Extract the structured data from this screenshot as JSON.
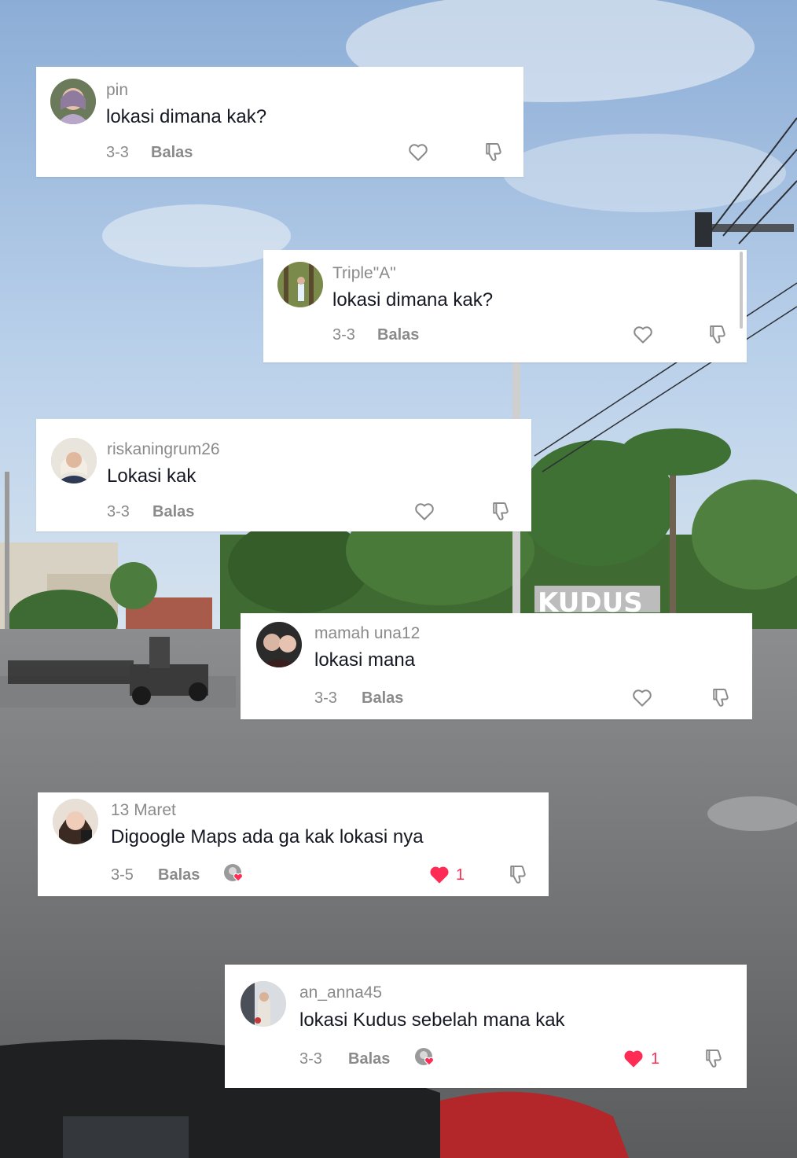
{
  "colors": {
    "sky_top": "#8fb0d8",
    "sky_bottom": "#c9dcee",
    "road": "#6e7072",
    "tree": "#3f6b32",
    "like_active": "#fe2c55",
    "muted_text": "#8a8a8a",
    "main_text": "#161823"
  },
  "scene": {
    "landmark_sign": "KUDUS"
  },
  "comments": [
    {
      "username": "pin",
      "text": "lokasi dimana kak?",
      "date": "3-3",
      "reply_label": "Balas",
      "likes": null,
      "liked": false,
      "creator_liked": false
    },
    {
      "username": "Triple\"A\"",
      "text": "lokasi dimana kak?",
      "date": "3-3",
      "reply_label": "Balas",
      "likes": null,
      "liked": false,
      "creator_liked": false
    },
    {
      "username": "riskaningrum26",
      "text": "Lokasi kak",
      "date": "3-3",
      "reply_label": "Balas",
      "likes": null,
      "liked": false,
      "creator_liked": false
    },
    {
      "username": "mamah una12",
      "text": "lokasi mana",
      "date": "3-3",
      "reply_label": "Balas",
      "likes": null,
      "liked": false,
      "creator_liked": false
    },
    {
      "username": "13 Maret",
      "text": "Digoogle Maps ada ga kak lokasi nya",
      "date": "3-5",
      "reply_label": "Balas",
      "likes": "1",
      "liked": true,
      "creator_liked": true
    },
    {
      "username": "an_anna45",
      "text": "lokasi Kudus sebelah mana kak",
      "date": "3-3",
      "reply_label": "Balas",
      "likes": "1",
      "liked": true,
      "creator_liked": true
    }
  ],
  "icons": {
    "like": "heart-outline-icon",
    "like_active": "heart-filled-icon",
    "dislike": "thumbs-down-icon",
    "creator_like": "creator-liked-badge-icon"
  }
}
